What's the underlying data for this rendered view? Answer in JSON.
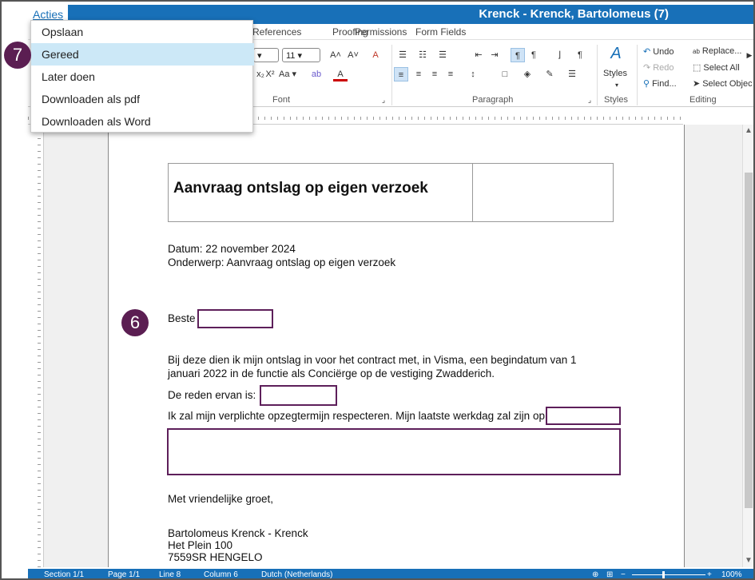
{
  "app": {
    "title": "Krenck - Krenck, Bartolomeus (7)",
    "acties_label": "Acties"
  },
  "menu": {
    "items": [
      "Opslaan",
      "Gereed",
      "Later doen",
      "Downloaden als pdf",
      "Downloaden als Word"
    ],
    "selected": "Gereed"
  },
  "badges": {
    "menu_step": "7",
    "doc_step": "6"
  },
  "ribbon": {
    "tabs": [
      "References",
      "Proofing",
      "Permissions",
      "Form Fields"
    ],
    "font": {
      "size": "11",
      "group_label": "Font",
      "case_label": "Aa"
    },
    "paragraph": {
      "group_label": "Paragraph"
    },
    "styles": {
      "label": "Styles",
      "group_label": "Styles"
    },
    "editing": {
      "undo": "Undo",
      "redo": "Redo",
      "find": "Find...",
      "replace": "Replace...",
      "select_all": "Select All",
      "select_objects": "Select Objec",
      "group_label": "Editing"
    }
  },
  "document": {
    "heading": "Aanvraag ontslag op eigen verzoek",
    "date_line": "Datum: 22 november 2024",
    "subject_line": "Onderwerp: Aanvraag ontslag op eigen verzoek",
    "salutation": "Beste",
    "body_line1": "Bij deze dien ik mijn ontslag in voor het contract met, in Visma, een begindatum van 1",
    "body_line2": "januari 2022 in de functie als Conciërge op de vestiging Zwadderich.",
    "reason_label": "De reden ervan is:",
    "notice_line": "Ik zal mijn verplichte opzegtermijn respecteren. Mijn laatste werkdag zal zijn op",
    "closing": "Met vriendelijke groet,",
    "sender_name": "Bartolomeus Krenck - Krenck",
    "sender_address": "Het Plein 100",
    "sender_city": "7559SR HENGELO"
  },
  "status": {
    "section": "Section 1/1",
    "page": "Page 1/1",
    "line": "Line 8",
    "column": "Column 6",
    "language": "Dutch (Netherlands)",
    "zoom": "100%"
  },
  "colors": {
    "accent": "#1870b8",
    "field_border": "#5d1f5a",
    "badge": "#5b1e52",
    "menu_highlight": "#cce8f7"
  }
}
